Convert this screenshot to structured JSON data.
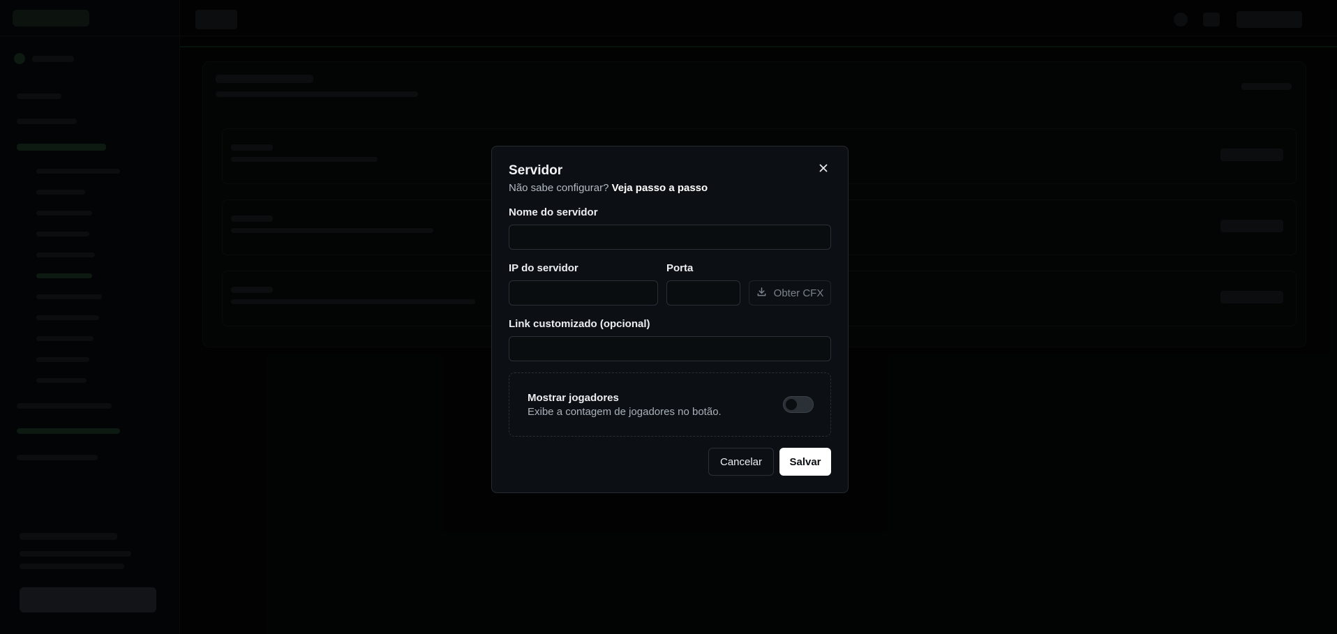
{
  "modal": {
    "title": "Servidor",
    "subtitle_prefix": "Não sabe configurar?",
    "subtitle_link": "Veja passo a passo",
    "close_icon": "close-icon",
    "fields": {
      "server_name_label": "Nome do servidor",
      "server_name_value": "",
      "server_ip_label": "IP do servidor",
      "server_ip_value": "",
      "port_label": "Porta",
      "port_value": "",
      "custom_link_label": "Link customizado (opcional)",
      "custom_link_value": ""
    },
    "cfx_button": {
      "label": "Obter CFX",
      "icon": "download-icon"
    },
    "toggle": {
      "title": "Mostrar jogadores",
      "description": "Exibe a contagem de jogadores no botão.",
      "enabled": false
    },
    "buttons": {
      "cancel": "Cancelar",
      "save": "Salvar"
    }
  }
}
